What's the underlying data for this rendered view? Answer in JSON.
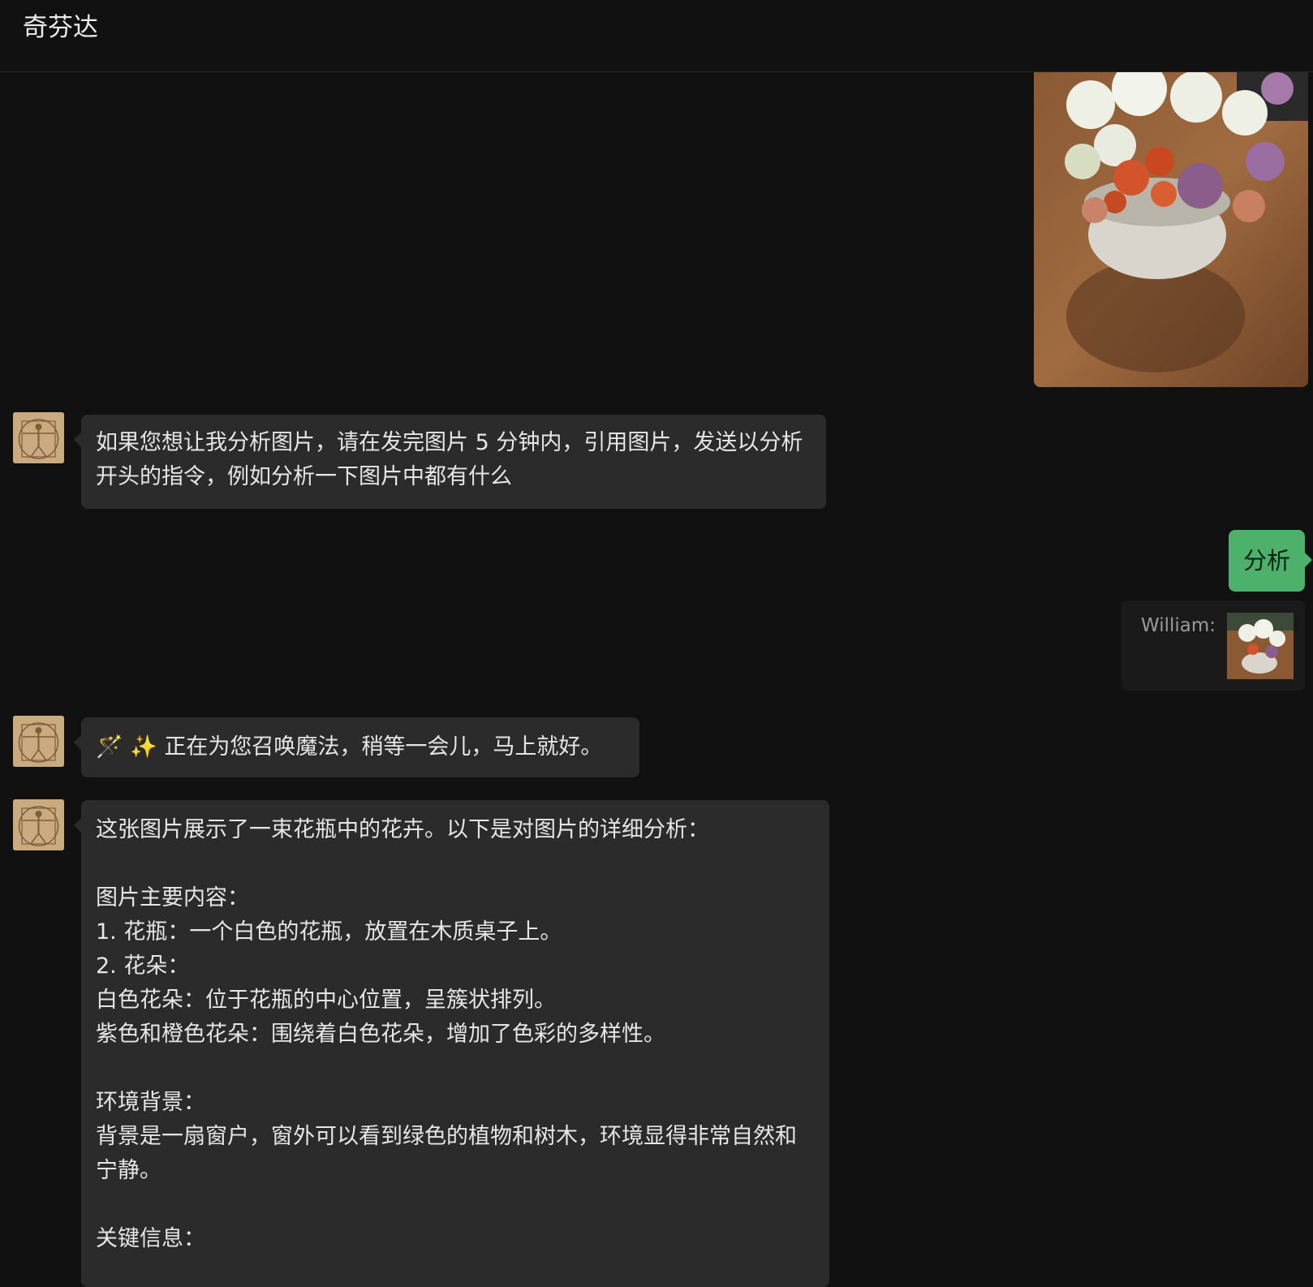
{
  "header": {
    "title": "奇芬达"
  },
  "messages": {
    "image_alt": "花瓶中的花卉照片",
    "bot1": {
      "text": "如果您想让我分析图片，请在发完图片 5 分钟内，引用图片，发送以分析开头的指令，例如分析一下图片中都有什么"
    },
    "user1": {
      "text": "分析"
    },
    "quote": {
      "label": "William:"
    },
    "bot2": {
      "wand": "🪄",
      "sparkles": "✨",
      "text": "正在为您召唤魔法，稍等一会儿，马上就好。"
    },
    "bot3": {
      "lines": [
        "这张图片展示了一束花瓶中的花卉。以下是对图片的详细分析：",
        "",
        "图片主要内容：",
        "1. 花瓶：一个白色的花瓶，放置在木质桌子上。",
        "2. 花朵：",
        "白色花朵：位于花瓶的中心位置，呈簇状排列。",
        "紫色和橙色花朵：围绕着白色花朵，增加了色彩的多样性。",
        "",
        "环境背景：",
        "背景是一扇窗户，窗外可以看到绿色的植物和树木，环境显得非常自然和宁静。",
        "",
        "关键信息："
      ]
    }
  },
  "colors": {
    "background": "#111111",
    "bubble": "#2b2b2b",
    "user_bubble": "#4db06b"
  }
}
